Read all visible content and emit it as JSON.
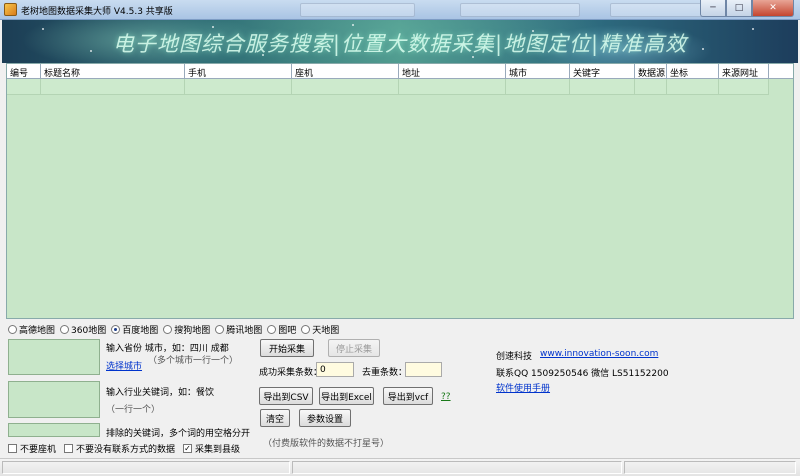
{
  "window": {
    "title": "老树地图数据采集大师 V4.5.3 共享版",
    "background_tabs": [
      "",
      "",
      ""
    ],
    "controls": {
      "minimize": "─",
      "maximize": "□",
      "close": "✕"
    }
  },
  "banner": {
    "title": "电子地图综合服务搜索|位置大数据采集|地图定位|精准高效"
  },
  "grid": {
    "columns": [
      "编号",
      "标题名称",
      "手机",
      "座机",
      "地址",
      "城市",
      "关键字",
      "数据源",
      "坐标",
      "来源网址"
    ]
  },
  "map_sources": {
    "options": [
      "高德地图",
      "360地图",
      "百度地图",
      "搜狗地图",
      "腾讯地图",
      "图吧",
      "天地图"
    ],
    "selected": "百度地图"
  },
  "city_input": {
    "label": "输入省份 城市，如：四川 成都",
    "hint": "（多个城市一行一个）",
    "select_link": "选择城市",
    "value": ""
  },
  "keyword_input": {
    "label": "输入行业关键词，如：餐饮",
    "hint": "（一行一个）",
    "value": ""
  },
  "exclude_input": {
    "label": "排除的关键词，多个词的用空格分开",
    "value": ""
  },
  "actions": {
    "start": "开始采集",
    "stop": "停止采集",
    "success_label": "成功采集条数：",
    "success_value": "0",
    "dedupe_label": "去重条数：",
    "dedupe_value": "",
    "export_csv": "导出到CSV",
    "export_excel": "导出到Excel",
    "export_vcf": "导出到vcf",
    "help_mark": "??",
    "clear": "清空",
    "settings": "参数设置",
    "note": "（付费版软件的数据不打星号）"
  },
  "company": {
    "name": "创速科技",
    "website": "www.innovation-soon.com",
    "contact": "联系QQ 1509250546  微信 LS51152200",
    "manual": "软件使用手册"
  },
  "options": {
    "no_landline": {
      "label": "不要座机",
      "checked": false
    },
    "no_contact": {
      "label": "不要没有联系方式的数据",
      "checked": false
    },
    "county_level": {
      "label": "采集到县级",
      "checked": true
    }
  },
  "icons": {
    "app": "tree-app-icon"
  }
}
